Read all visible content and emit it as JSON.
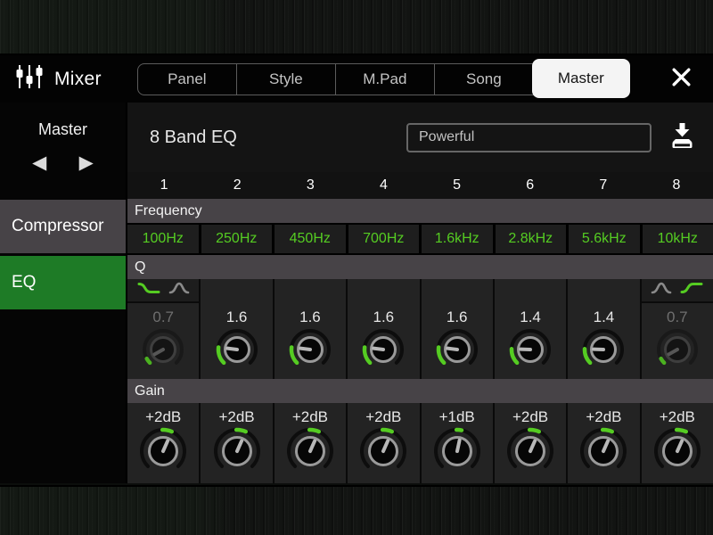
{
  "top_bar": {
    "title": "Mixer",
    "tabs": [
      {
        "label": "Panel",
        "active": false
      },
      {
        "label": "Style",
        "active": false
      },
      {
        "label": "M.Pad",
        "active": false
      },
      {
        "label": "Song",
        "active": false
      },
      {
        "label": "Master",
        "active": true
      }
    ]
  },
  "icons": {
    "mixer": "mixer-faders",
    "close": "close-x",
    "prev": "◀",
    "next": "▶",
    "save": "save-to-drive"
  },
  "sidebar": {
    "channel": "Master",
    "items": [
      {
        "label": "Compressor",
        "active": false
      },
      {
        "label": "EQ",
        "active": true
      }
    ]
  },
  "eq": {
    "title": "8 Band EQ",
    "preset": "Powerful",
    "bands": [
      "1",
      "2",
      "3",
      "4",
      "5",
      "6",
      "7",
      "8"
    ],
    "frequency": {
      "label": "Frequency",
      "values": [
        "100Hz",
        "250Hz",
        "450Hz",
        "700Hz",
        "1.6kHz",
        "2.8kHz",
        "5.6kHz",
        "10kHz"
      ]
    },
    "q": {
      "label": "Q",
      "values": [
        "0.7",
        "1.6",
        "1.6",
        "1.6",
        "1.6",
        "1.4",
        "1.4",
        "0.7"
      ],
      "enabled": [
        false,
        true,
        true,
        true,
        true,
        true,
        true,
        false
      ]
    },
    "gain": {
      "label": "Gain",
      "values": [
        "+2dB",
        "+2dB",
        "+2dB",
        "+2dB",
        "+1dB",
        "+2dB",
        "+2dB",
        "+2dB"
      ],
      "db": [
        2,
        2,
        2,
        2,
        1,
        2,
        2,
        2
      ]
    },
    "band1_filter": {
      "types": [
        "low-shelf",
        "peak"
      ],
      "selected": "low-shelf"
    },
    "band8_filter": {
      "types": [
        "peak",
        "high-shelf"
      ],
      "selected": "high-shelf"
    }
  },
  "colors": {
    "accent_green": "#55cc22",
    "selected_item_green": "#1e7b26",
    "row_header_gray": "#474347"
  }
}
